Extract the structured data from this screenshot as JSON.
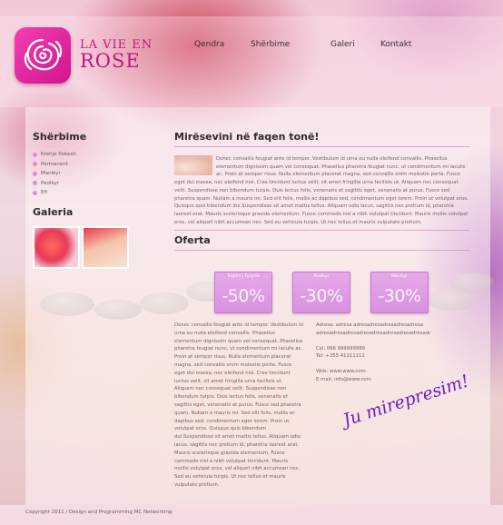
{
  "brand": {
    "line1": "LA VIE EN",
    "line2": "ROSE",
    "logo_icon": "rose-icon",
    "accent": "#d1158f"
  },
  "nav": {
    "items": [
      {
        "label": "Qendra"
      },
      {
        "label": "Shërbime"
      },
      {
        "label": "Galeri"
      },
      {
        "label": "Kontakt"
      }
    ]
  },
  "sidebar": {
    "services_title": "Shërbime",
    "services": [
      {
        "label": "Krehje flokesh"
      },
      {
        "label": "Permanent"
      },
      {
        "label": "Manikyr"
      },
      {
        "label": "Pedikyr"
      },
      {
        "label": "Efi"
      }
    ],
    "gallery_title": "Galeria"
  },
  "welcome": {
    "heading": "Mirësevini në faqen tonë!",
    "body": "Donec convallis feugiat ante id tempor. Vestibulum id urna eu nulla eleifend convallis. Phasellus elementum dignissim quam vel consequat. Phasellus pharetra feugiat nunc, ut condimentum mi iaculis ac. Proin at semper risus. Nulla elementum placerat magna, sed convallis enim molestie porta. Fusce eget dui massa, nec eleifend nisl. Cras tincidunt luctus velit, sit amet fringilla urna facilisis ut. Aliquam nec consequat velit. Suspendisse non bibendum turpis. Duis lectus felis, venenatis et sagittis eget, venenatis at purus. Fusce sed pharetra quam. Nullam a mauris mi. Sed elit felis, mollis ac dapibus sed, condimentum eget lorem. Proin ut volutpat eros. Quisque quis bibendum dui.Suspendisse sit amet mattis tellus. Aliquam odio lacus, sagittis nec pretium id, pharetra laoreet erat. Mauris scelerisque gravida elementum. Fusce commodo nisl a nibh volutpat tincidunt. Mauris mollis volutpat eros, vel aliquet nibh accumsan nec. Sed eu vehicula turpis. Ut nec tellus et mauris vulputate pretium."
  },
  "offers": {
    "heading": "Oferta",
    "items": [
      {
        "label": "Trajtim i Fytyrës",
        "percent": "-50%"
      },
      {
        "label": "Pedikyr",
        "percent": "-30%"
      },
      {
        "label": "Manikyr",
        "percent": "-30%"
      }
    ],
    "body": "Donec convallis feugiat ante id tempor. Vestibulum id urna eu nulla eleifend convallis. Phasellus elementum dignissim quam vel consequat. Phasellus pharetra feugiat nunc, ut condimentum mi iaculis ac. Proin at semper risus. Nulla elementum placerat magna, sed convallis enim molestie porta. Fusce eget dui massa, nec eleifend nisl. Cras tincidunt luctus velit, sit amet fringilla urna facilisis ut. Aliquam nec consequat velit. Suspendisse non bibendum turpis. Duis lectus felis, venenatis et sagittis eget, venenatis at purus. Fusce sed pharetra quam. Nullam a mauris mi. Sed elit felis, mollis ac dapibus sed, condimentum eget lorem. Proin ut volutpat eros. Quisque quis bibendum dui.Suspendisse sit amet mattis tellus. Aliquam odio lacus, sagittis nec pretium id, pharetra laoreet erat. Mauris scelerisque gravida elementum. Fusce commodo nisl a nibh volutpat tincidunt. Mauris mollis volutpat eros, vel aliquet nibh accumsan nec. Sed eu vehicula turpis. Ut nec tellus et mauris vulputate pretium."
  },
  "contact": {
    "address": "Adresa: adresa adresadresadresadresadresa adresadresadresadresadresadresadresadresadr",
    "phone": "Cel: 066 999999999",
    "tel": "Tel: +355 41111111",
    "web": "Web: www.www.com",
    "email": "E-mail: info@www.com"
  },
  "tagline": "Ju mirepresim!",
  "footer": "Copyright 2011 / Design and Programming MC Networking"
}
